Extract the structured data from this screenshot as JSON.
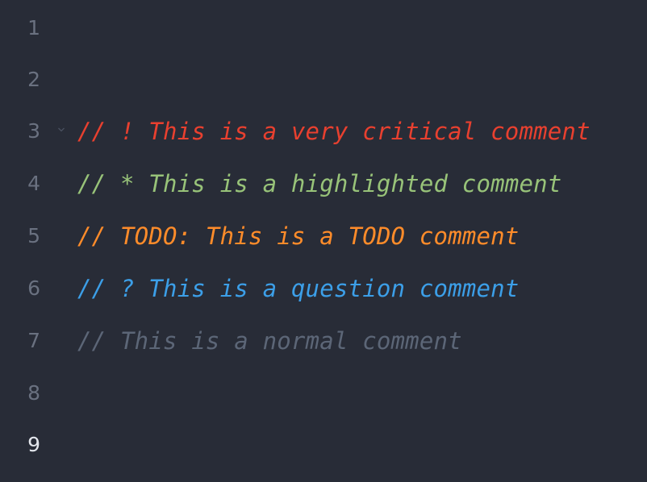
{
  "editor": {
    "lines": [
      {
        "number": "1",
        "text": ""
      },
      {
        "number": "2",
        "text": ""
      },
      {
        "number": "3",
        "text": "// ! This is a very critical comment",
        "color": "#e8402f"
      },
      {
        "number": "4",
        "text": "// * This is a highlighted comment",
        "color": "#98c379"
      },
      {
        "number": "5",
        "text": "// TODO: This is a TODO comment",
        "color": "#ff8c2a"
      },
      {
        "number": "6",
        "text": "// ? This is a question comment",
        "color": "#3c9fe8"
      },
      {
        "number": "7",
        "text": "// This is a normal comment",
        "color": "#5c6677"
      },
      {
        "number": "8",
        "text": ""
      },
      {
        "number": "9",
        "text": ""
      }
    ],
    "active_line": "9",
    "fold_icon": "chevron-down-icon",
    "colors": {
      "background": "#282c37",
      "gutter": "#6a7180",
      "gutter_active": "#e3e6ec"
    }
  }
}
